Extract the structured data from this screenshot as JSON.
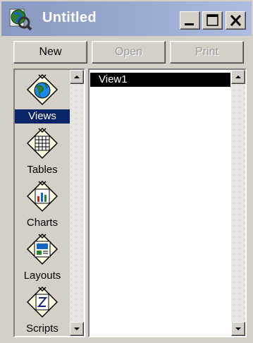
{
  "window": {
    "title": "Untitled"
  },
  "toolbar": {
    "new_label": "New",
    "open_label": "Open",
    "print_label": "Print"
  },
  "doc_types": [
    {
      "label": "Views",
      "icon": "globe-icon",
      "selected": true
    },
    {
      "label": "Tables",
      "icon": "table-icon",
      "selected": false
    },
    {
      "label": "Charts",
      "icon": "chart-icon",
      "selected": false
    },
    {
      "label": "Layouts",
      "icon": "layout-icon",
      "selected": false
    },
    {
      "label": "Scripts",
      "icon": "script-icon",
      "selected": false
    }
  ],
  "documents": [
    "View1"
  ],
  "colors": {
    "selection": "#0a246a",
    "titlebar": "#9aaad0",
    "face": "#d4d0c8"
  }
}
